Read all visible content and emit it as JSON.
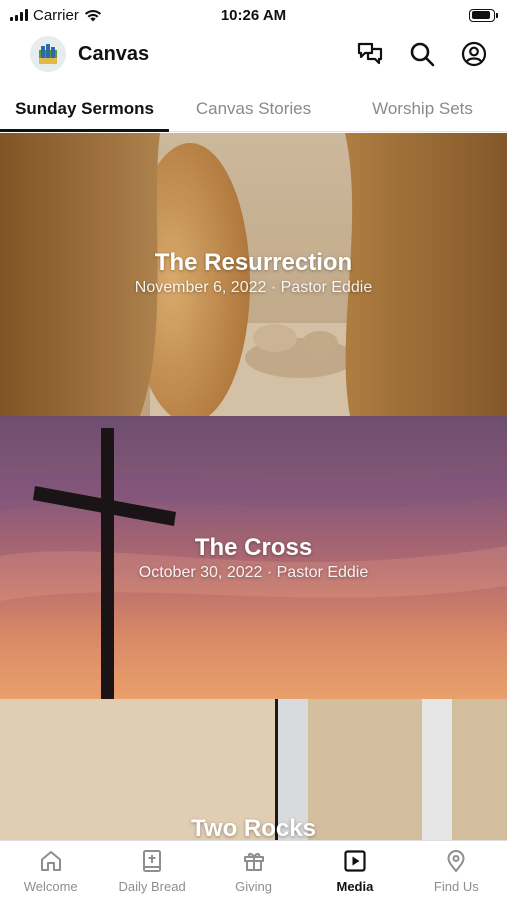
{
  "status_bar": {
    "carrier": "Carrier",
    "time": "10:26 AM",
    "battery_level": 0.9
  },
  "app": {
    "title": "Canvas"
  },
  "header_icons": [
    "chat-icon",
    "search-icon",
    "profile-icon"
  ],
  "tabs": [
    {
      "label": "Sunday Sermons",
      "active": true
    },
    {
      "label": "Canvas Stories",
      "active": false
    },
    {
      "label": "Worship Sets",
      "active": false
    }
  ],
  "sermons": [
    {
      "title": "The Resurrection",
      "subtitle": "November 6, 2022 · Pastor Eddie"
    },
    {
      "title": "The Cross",
      "subtitle": "October 30, 2022 · Pastor Eddie"
    },
    {
      "title": "Two Rocks",
      "subtitle": ""
    }
  ],
  "bottom_nav": [
    {
      "label": "Welcome",
      "icon": "home-icon",
      "active": false
    },
    {
      "label": "Daily Bread",
      "icon": "bible-icon",
      "active": false
    },
    {
      "label": "Giving",
      "icon": "gift-icon",
      "active": false
    },
    {
      "label": "Media",
      "icon": "play-icon",
      "active": true
    },
    {
      "label": "Find Us",
      "icon": "location-pin-icon",
      "active": false
    }
  ],
  "colors": {
    "active": "#111111",
    "inactive": "#8e8e8e",
    "background": "#ffffff"
  }
}
